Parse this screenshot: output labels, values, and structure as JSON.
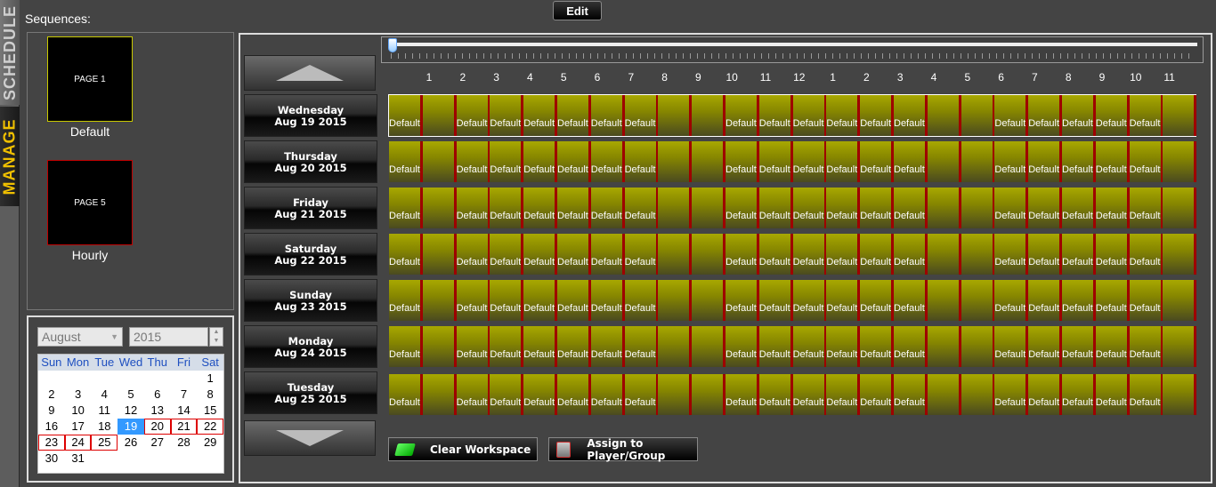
{
  "tabs": {
    "schedule": "SCHEDULE",
    "manage": "MANAGE"
  },
  "header": {
    "sequences_label": "Sequences:",
    "edit_label": "Edit"
  },
  "sequences": [
    {
      "page": "PAGE 1",
      "name": "Default",
      "border": "#c8c800"
    },
    {
      "page": "PAGE 5",
      "name": "Hourly",
      "border": "#c00000"
    }
  ],
  "calendar": {
    "month": "August",
    "year": "2015",
    "weekdays": [
      "Sun",
      "Mon",
      "Tue",
      "Wed",
      "Thu",
      "Fri",
      "Sat"
    ],
    "weeks": [
      [
        "",
        "",
        "",
        "",
        "",
        "",
        "1"
      ],
      [
        "2",
        "3",
        "4",
        "5",
        "6",
        "7",
        "8"
      ],
      [
        "9",
        "10",
        "11",
        "12",
        "13",
        "14",
        "15"
      ],
      [
        "16",
        "17",
        "18",
        "19",
        "20",
        "21",
        "22"
      ],
      [
        "23",
        "24",
        "25",
        "26",
        "27",
        "28",
        "29"
      ],
      [
        "30",
        "31",
        "",
        "",
        "",
        "",
        ""
      ]
    ],
    "today": "19",
    "marked": [
      "20",
      "21",
      "22",
      "23",
      "24",
      "25"
    ]
  },
  "hours": [
    "1",
    "2",
    "3",
    "4",
    "5",
    "6",
    "7",
    "8",
    "9",
    "10",
    "11",
    "12",
    "1",
    "2",
    "3",
    "4",
    "5",
    "6",
    "7",
    "8",
    "9",
    "10",
    "11"
  ],
  "days": [
    {
      "dow": "Wednesday",
      "date": "Aug 19 2015"
    },
    {
      "dow": "Thursday",
      "date": "Aug 20 2015"
    },
    {
      "dow": "Friday",
      "date": "Aug 21 2015"
    },
    {
      "dow": "Saturday",
      "date": "Aug 22 2015"
    },
    {
      "dow": "Sunday",
      "date": "Aug 23 2015"
    },
    {
      "dow": "Monday",
      "date": "Aug 24 2015"
    },
    {
      "dow": "Tuesday",
      "date": "Aug 25 2015"
    }
  ],
  "selected_day": 0,
  "slot_label": "Default",
  "slots": [
    true,
    false,
    true,
    true,
    true,
    true,
    true,
    true,
    false,
    false,
    true,
    true,
    true,
    true,
    true,
    true,
    false,
    false,
    true,
    true,
    true,
    true,
    true,
    false
  ],
  "actions": {
    "clear": "Clear Workspace",
    "assign": "Assign to Player/Group"
  },
  "colors": {
    "cell": "#9a9a00",
    "separator": "#9e0000",
    "today": "#3399ff",
    "accent": "#f0c000"
  }
}
